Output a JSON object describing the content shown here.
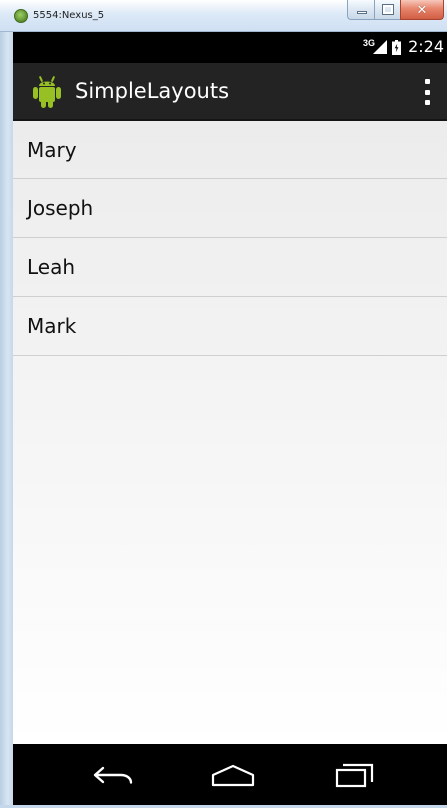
{
  "window": {
    "title": "5554:Nexus_5",
    "controls": {
      "minimize_icon": "minimize-icon",
      "maximize_icon": "maximize-icon",
      "close_icon": "close-icon",
      "close_glyph": "✕"
    }
  },
  "status_bar": {
    "network_type": "3G",
    "signal_icon": "signal-icon",
    "battery_icon": "battery-icon",
    "time": "2:24"
  },
  "action_bar": {
    "logo_icon": "android-logo-icon",
    "title": "SimpleLayouts",
    "overflow_icon": "overflow-menu-icon"
  },
  "list": {
    "items": [
      {
        "label": "Mary"
      },
      {
        "label": "Joseph"
      },
      {
        "label": "Leah"
      },
      {
        "label": "Mark"
      }
    ]
  },
  "navigation_bar": {
    "back_icon": "back-icon",
    "home_icon": "home-icon",
    "recent_apps_icon": "recent-apps-icon"
  },
  "colors": {
    "status_bar": "#000000",
    "action_bar": "#232323",
    "list_background": "#f3f3f3",
    "divider": "#cfcfcf",
    "android_green": "#97c024",
    "navigation_bar": "#000000"
  }
}
